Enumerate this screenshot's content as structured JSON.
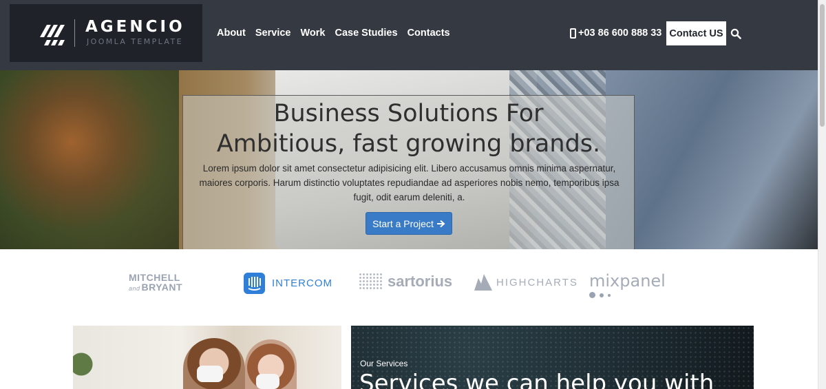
{
  "header": {
    "logo_title": "AGENCIO",
    "logo_subtitle": "JOOMLA TEMPLATE",
    "nav": [
      "About",
      "Service",
      "Work",
      "Case Studies",
      "Contacts"
    ],
    "phone": "+03 86 600 888 33",
    "contact_button": "Contact US",
    "icons": {
      "phone": "mobile-phone-icon",
      "search": "search-icon",
      "logo": "agencio-logo-mark"
    }
  },
  "hero": {
    "title_line1": "Business Solutions For",
    "title_line2": "Ambitious, fast growing brands.",
    "text": "Lorem ipsum dolor sit amet consectetur adipisicing elit. Libero accusamus omnis minima aspernatur, maiores corporis. Harum distinctio voluptates repudiandae ad asperiores nobis nemo, temporibus ipsa fugit, odit earum deleniti, a.",
    "button_label": "Start a Project",
    "button_icon": "arrow-right-icon"
  },
  "brands": {
    "mitchell_line1": "MITCHELL",
    "mitchell_and": "and",
    "mitchell_line2": "BRYANT",
    "intercom": "INTERCOM",
    "sartorius": "sartorius",
    "highcharts": "HIGHCHARTS",
    "mixpanel": "mixpanel"
  },
  "services": {
    "label": "Our Services",
    "title": "Services we can help you with"
  },
  "colors": {
    "header_bg": "#353a42",
    "logo_bg": "#1f2329",
    "accent_button": "#3a7bc8",
    "intercom_blue": "#2f7fd9"
  }
}
